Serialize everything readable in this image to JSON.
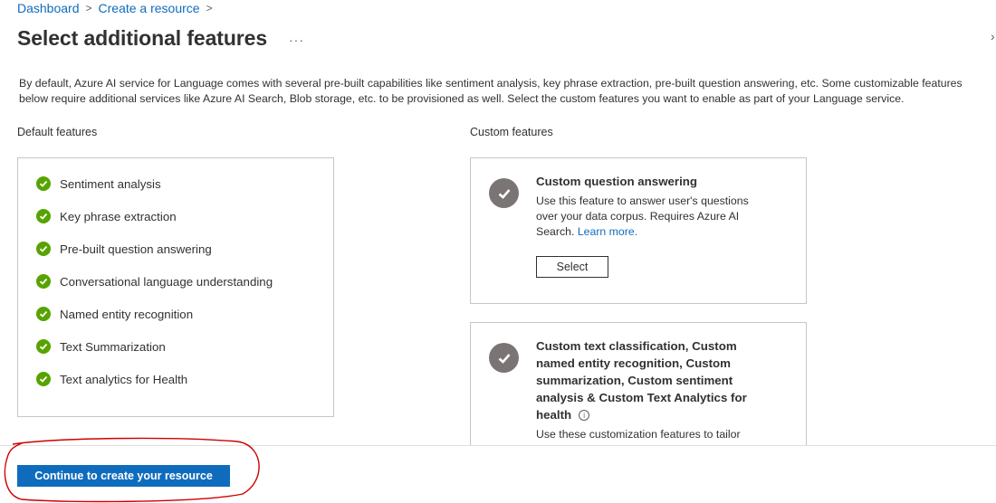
{
  "breadcrumb": {
    "items": [
      "Dashboard",
      "Create a resource"
    ],
    "separator": ">"
  },
  "header": {
    "title": "Select additional features",
    "more": "···"
  },
  "intro": "By default, Azure AI service for Language comes with several pre-built capabilities like sentiment analysis, key phrase extraction, pre-built question answering, etc. Some customizable features below require additional services like Azure AI Search, Blob storage, etc. to be provisioned as well. Select the custom features you want to enable as part of your Language service.",
  "default_features": {
    "label": "Default features",
    "items": [
      "Sentiment analysis",
      "Key phrase extraction",
      "Pre-built question answering",
      "Conversational language understanding",
      "Named entity recognition",
      "Text Summarization",
      "Text analytics for Health"
    ]
  },
  "custom_features": {
    "label": "Custom features",
    "cards": [
      {
        "title": "Custom question answering",
        "description": "Use this feature to answer user's questions over your data corpus. Requires Azure AI Search.",
        "link": "Learn more.",
        "button": "Select"
      },
      {
        "title": "Custom text classification, Custom named entity recognition, Custom summarization, Custom sentiment analysis & Custom Text Analytics for health",
        "description": "Use these customization features to tailor"
      }
    ]
  },
  "footer": {
    "continue_label": "Continue to create your resource"
  },
  "colors": {
    "link": "#0f6cbd",
    "primary_button": "#0f6cbd",
    "check_green": "#57a300",
    "check_grey": "#7a7574",
    "annotation_red": "#d00000"
  }
}
